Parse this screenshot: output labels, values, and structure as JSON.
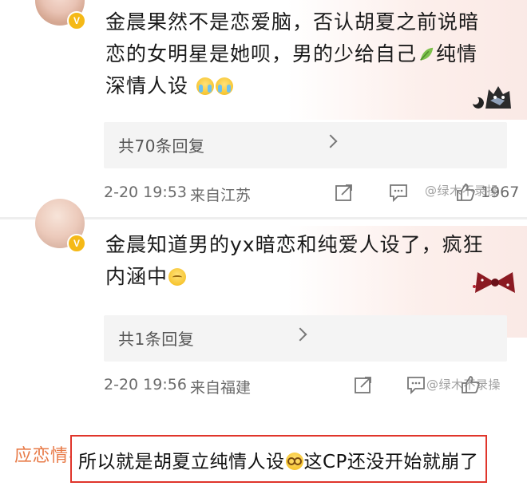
{
  "comments": [
    {
      "text_lines": [
        "金晨果然不是恋爱脑，否认胡夏之前说暗",
        "恋的女明星是她呗，男的少给自己",
        "纯情",
        "深情人设"
      ],
      "emojis": [
        "leaf-icon",
        "crying-face-icon",
        "crying-face-icon"
      ],
      "replies_label": "共70条回复",
      "time": "2-20 19:53",
      "source": "来自江苏",
      "likes": "1967",
      "watermark": "@绿木不录操"
    },
    {
      "text_lines": [
        "金晨知道男的yx暗恋和纯爱人设了，疯狂",
        "内涵中"
      ],
      "emojis": [
        "relieved-face-icon"
      ],
      "replies_label": "共1条回复",
      "time": "2-20 19:56",
      "source": "来自福建",
      "likes": "",
      "watermark": "@绿木不录操"
    }
  ],
  "caption": {
    "hashtag": "应恋情#",
    "text_before": "所以就是胡夏立纯情人设",
    "text_after": "这CP还没开始就崩了",
    "emoji": "dizzy-face-icon"
  },
  "colors": {
    "caption_border": "#e0352b",
    "hashtag": "#e87b48",
    "verified_badge": "#f5b917",
    "meta_text": "#6b6b6b"
  }
}
